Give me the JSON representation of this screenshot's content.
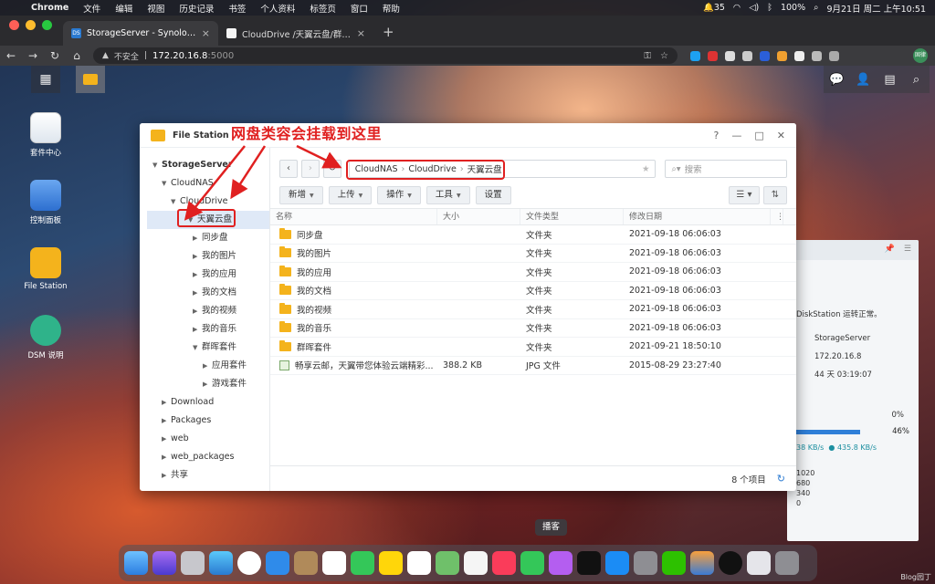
{
  "menubar": {
    "app": "Chrome",
    "items": [
      "文件",
      "编辑",
      "视图",
      "历史记录",
      "书签",
      "个人资料",
      "标签页",
      "窗口",
      "帮助"
    ],
    "badge_count": "35",
    "battery": "100%",
    "datetime": "9月21日 周二 上午10:51"
  },
  "browser": {
    "tabs": [
      {
        "title": "StorageServer - Synology DiskS",
        "active": true
      },
      {
        "title": "CloudDrive /天翼云盘/群晖套件",
        "active": false
      }
    ],
    "security_label": "不安全",
    "url_host": "172.20.16.8",
    "url_port": ":5000",
    "profile_label": "固律"
  },
  "desktop": {
    "icons": [
      {
        "label": "套件中心"
      },
      {
        "label": "控制面板"
      },
      {
        "label": "File Station"
      },
      {
        "label": "DSM 说明"
      }
    ]
  },
  "annotation": "网盘类容会挂载到这里",
  "window": {
    "title": "File Station",
    "help": "?",
    "minimize": "—",
    "maximize": "□",
    "close": "✕"
  },
  "tree": {
    "root": "StorageServer",
    "cloudnas": "CloudNAS",
    "clouddrive": "CloudDrive",
    "tianyi": "天翼云盘",
    "children": [
      "同步盘",
      "我的图片",
      "我的应用",
      "我的文档",
      "我的视频",
      "我的音乐"
    ],
    "qunhui": "群晖套件",
    "qunhui_children": [
      "应用套件",
      "游戏套件"
    ],
    "others": [
      "Download",
      "Packages",
      "web",
      "web_packages",
      "共享"
    ]
  },
  "toolbar": {
    "path": [
      "CloudNAS",
      "CloudDrive",
      "天翼云盘"
    ],
    "search_placeholder": "搜索",
    "buttons": {
      "new": "新增",
      "upload": "上传",
      "action": "操作",
      "tools": "工具",
      "settings": "设置"
    }
  },
  "table": {
    "headers": {
      "name": "名称",
      "size": "大小",
      "type": "文件类型",
      "modified": "修改日期"
    },
    "rows": [
      {
        "name": "同步盘",
        "size": "",
        "type": "文件夹",
        "modified": "2021-09-18 06:06:03",
        "kind": "folder"
      },
      {
        "name": "我的图片",
        "size": "",
        "type": "文件夹",
        "modified": "2021-09-18 06:06:03",
        "kind": "folder"
      },
      {
        "name": "我的应用",
        "size": "",
        "type": "文件夹",
        "modified": "2021-09-18 06:06:03",
        "kind": "folder"
      },
      {
        "name": "我的文档",
        "size": "",
        "type": "文件夹",
        "modified": "2021-09-18 06:06:03",
        "kind": "folder"
      },
      {
        "name": "我的视频",
        "size": "",
        "type": "文件夹",
        "modified": "2021-09-18 06:06:03",
        "kind": "folder"
      },
      {
        "name": "我的音乐",
        "size": "",
        "type": "文件夹",
        "modified": "2021-09-18 06:06:03",
        "kind": "folder"
      },
      {
        "name": "群晖套件",
        "size": "",
        "type": "文件夹",
        "modified": "2021-09-21 18:50:10",
        "kind": "folder"
      },
      {
        "name": "畅享云邮，天翼带您体验云端精彩...",
        "size": "388.2 KB",
        "type": "JPG 文件",
        "modified": "2015-08-29 23:27:40",
        "kind": "image"
      }
    ],
    "item_count": "8 个项目"
  },
  "widget": {
    "status": "DiskStation 运转正常。",
    "server": "StorageServer",
    "ip": "172.20.16.8",
    "uptime": "44 天 03:19:07",
    "cpu": "0%",
    "ram": "46%",
    "net_up": "38 KB/s",
    "net_down": "435.8 KB/s",
    "axis": [
      "1020",
      "680",
      "340",
      "0"
    ]
  },
  "dock": {
    "tooltip": "播客"
  },
  "watermark": "Blog园丁"
}
